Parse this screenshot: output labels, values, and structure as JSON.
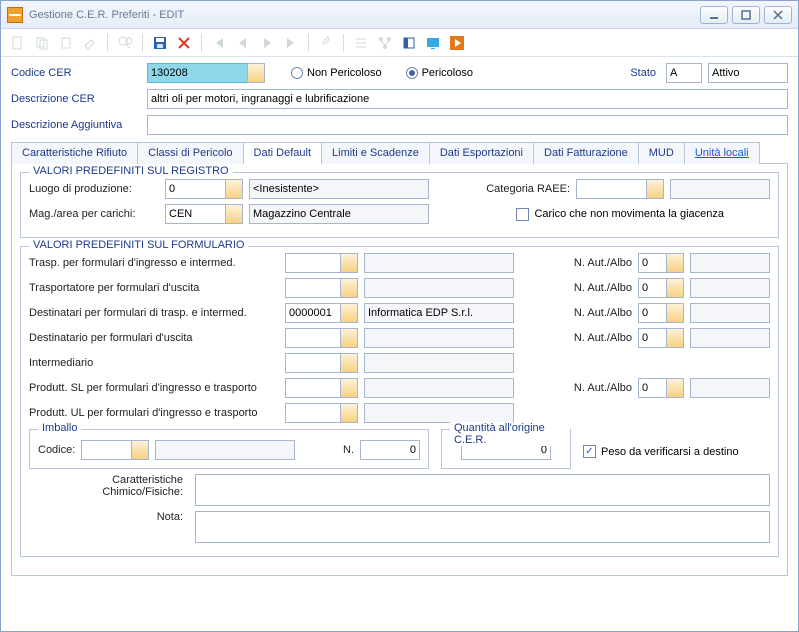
{
  "window": {
    "title": "Gestione C.E.R. Preferiti - EDIT"
  },
  "header": {
    "codice_label": "Codice CER",
    "codice_value": "130208",
    "radio_non_pericoloso": "Non Pericoloso",
    "radio_pericoloso": "Pericoloso",
    "pericoloso_selected": "pericoloso",
    "stato_label": "Stato",
    "stato_code": "A",
    "stato_desc": "Attivo",
    "descr_cer_label": "Descrizione CER",
    "descr_cer_value": "altri oli per motori, ingranaggi e lubrificazione",
    "descr_agg_label": "Descrizione Aggiuntiva",
    "descr_agg_value": ""
  },
  "tabs": {
    "items": [
      "Caratteristiche Rifiuto",
      "Classi di Pericolo",
      "Dati Default",
      "Limiti e Scadenze",
      "Dati Esportazioni",
      "Dati Fatturazione",
      "MUD",
      "Unità locali"
    ],
    "active_index": 2,
    "link_index": 7
  },
  "registro": {
    "legend": "VALORI PREDEFINITI SUL REGISTRO",
    "luogo_label": "Luogo di produzione:",
    "luogo_code": "0",
    "luogo_desc": "<Inesistente>",
    "categoria_raee_label": "Categoria RAEE:",
    "categoria_raee_code": "",
    "categoria_raee_desc": "",
    "mag_label": "Mag./area per carichi:",
    "mag_code": "CEN",
    "mag_desc": "Magazzino Centrale",
    "carico_chk_label": "Carico che non movimenta la giacenza",
    "carico_chk_checked": false
  },
  "formulario": {
    "legend": "VALORI PREDEFINITI SUL FORMULARIO",
    "rows": {
      "trasp_ingresso": {
        "label": "Trasp. per formulari d'ingresso e intermed.",
        "code": "",
        "desc": "",
        "naut_label": "N. Aut./Albo",
        "naut": "0",
        "naut_desc": ""
      },
      "trasp_uscita": {
        "label": "Trasportatore per formulari d'uscita",
        "code": "",
        "desc": "",
        "naut_label": "N. Aut./Albo",
        "naut": "0",
        "naut_desc": ""
      },
      "dest_ingresso": {
        "label": "Destinatari per formulari di trasp. e intermed.",
        "code": "0000001",
        "desc": "Informatica EDP S.r.l.",
        "naut_label": "N. Aut./Albo",
        "naut": "0",
        "naut_desc": ""
      },
      "dest_uscita": {
        "label": "Destinatario per formulari d'uscita",
        "code": "",
        "desc": "",
        "naut_label": "N. Aut./Albo",
        "naut": "0",
        "naut_desc": ""
      },
      "intermediario": {
        "label": "Intermediario",
        "code": "",
        "desc": ""
      },
      "prod_sl": {
        "label": "Produtt. SL per formulari d'ingresso e trasporto",
        "code": "",
        "desc": "",
        "naut_label": "N. Aut./Albo",
        "naut": "0",
        "naut_desc": ""
      },
      "prod_ul": {
        "label": "Produtt. UL per formulari d'ingresso e trasporto",
        "code": "",
        "desc": ""
      }
    },
    "imballo": {
      "legend": "Imballo",
      "codice_label": "Codice:",
      "codice": "",
      "desc": "",
      "n_label": "N.",
      "n": "0"
    },
    "qta": {
      "legend": "Quantità all'origine C.E.R.",
      "value": "0"
    },
    "peso_chk_label": "Peso da verificarsi a destino",
    "peso_chk_checked": true,
    "car_chim_label": "Caratteristiche Chimico/Fisiche:",
    "car_chim_value": "",
    "nota_label": "Nota:",
    "nota_value": ""
  }
}
